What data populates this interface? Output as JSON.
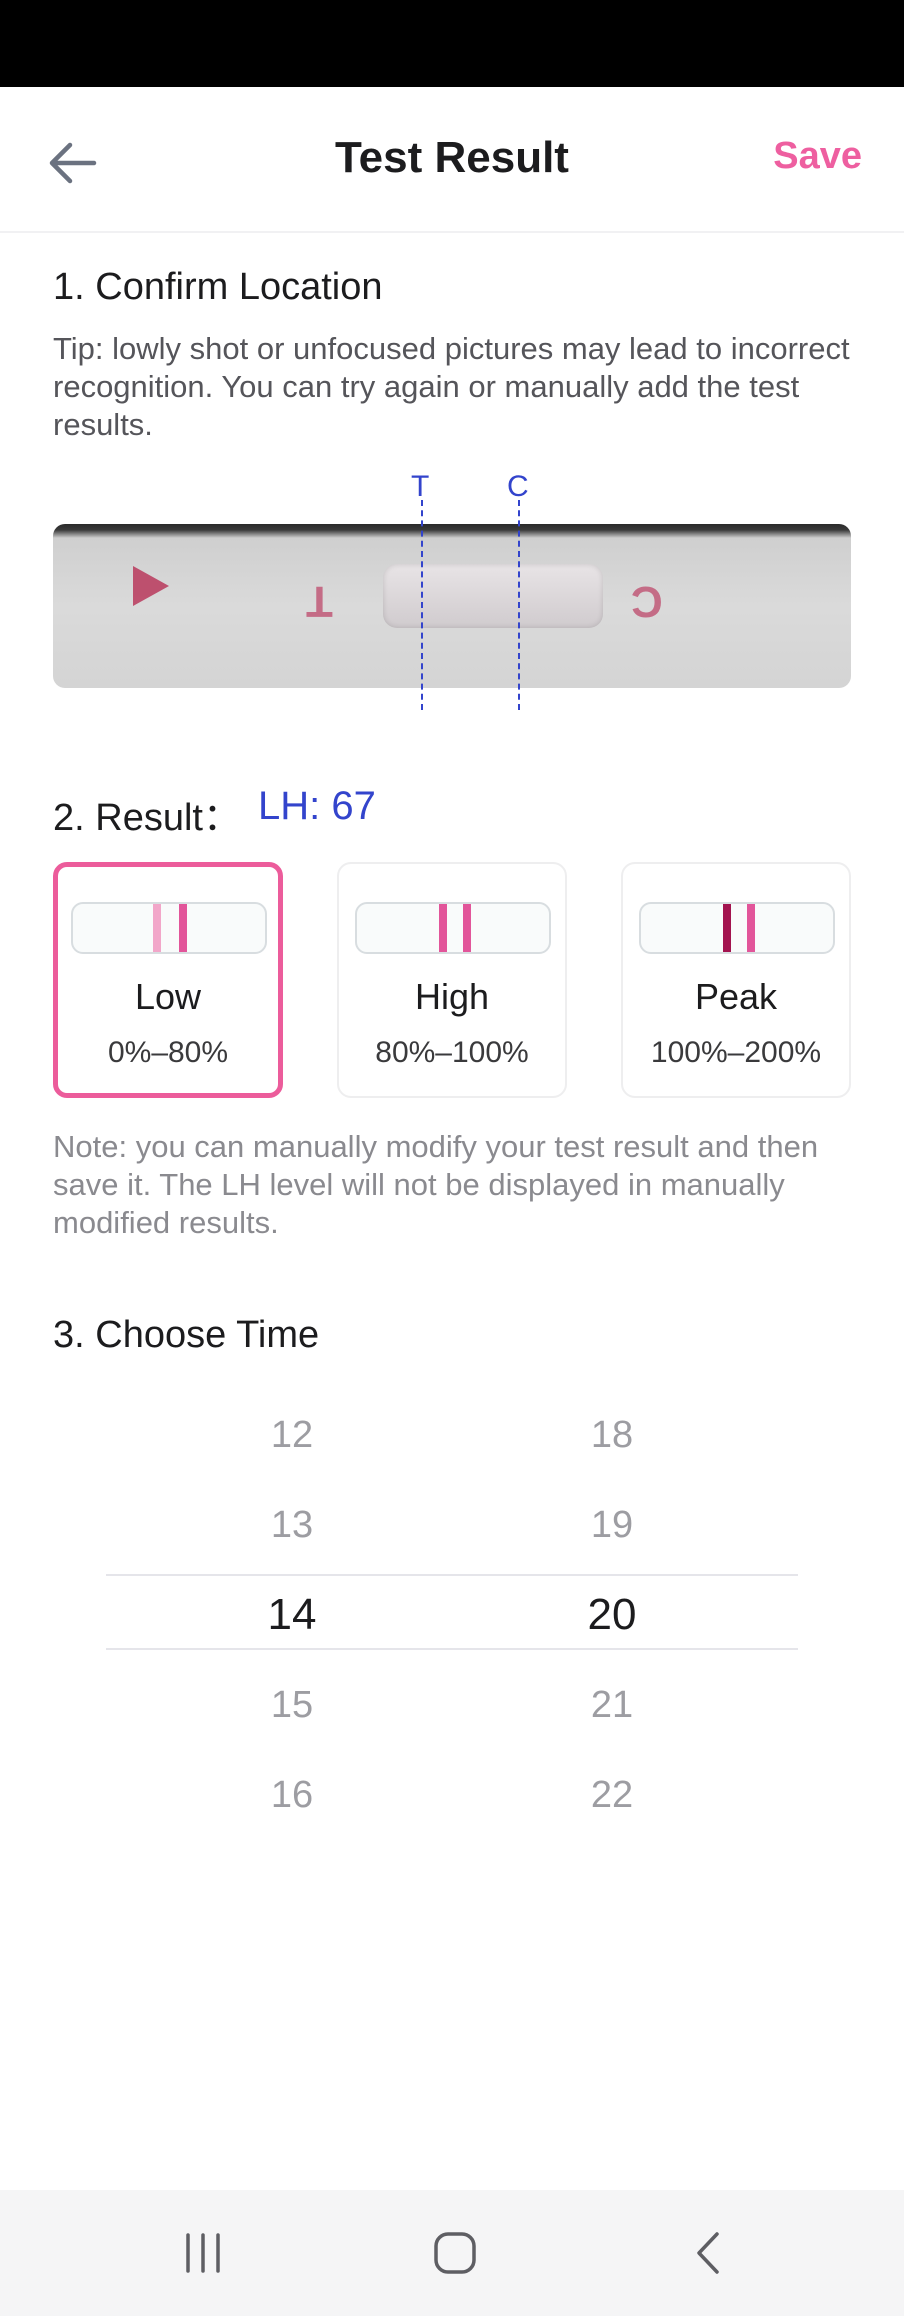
{
  "header": {
    "title": "Test Result",
    "save_label": "Save"
  },
  "location": {
    "heading": "1. Confirm Location",
    "tip": "Tip: lowly shot or unfocused pictures may lead to incorrect recognition. You can try again or manually add the test results.",
    "marker_t": "T",
    "marker_c": "C",
    "strip_letter_t": "T",
    "strip_letter_c": "C"
  },
  "result": {
    "heading": "2. Result：",
    "lh_value": "LH: 67",
    "options": [
      {
        "label": "Low",
        "range": "0%–80%",
        "selected": true,
        "t_color": "#f2a6c9",
        "c_color": "#e2559a"
      },
      {
        "label": "High",
        "range": "80%–100%",
        "selected": false,
        "t_color": "#e2559a",
        "c_color": "#e2559a"
      },
      {
        "label": "Peak",
        "range": "100%–200%",
        "selected": false,
        "t_color": "#a3134f",
        "c_color": "#e2559a"
      }
    ],
    "note": "Note: you can manually modify your test result and then save it. The LH level will not be displayed in manually modified results."
  },
  "time": {
    "heading": "3. Choose Time",
    "hours": [
      "12",
      "13",
      "14",
      "15",
      "16"
    ],
    "minutes": [
      "18",
      "19",
      "20",
      "21",
      "22"
    ],
    "selected_hour": "14",
    "selected_minute": "20"
  },
  "colors": {
    "accent": "#ee5fa0",
    "lh_blue": "#3344cc"
  },
  "icons": {
    "back": "arrow-left-icon",
    "recents": "recent-apps-icon",
    "home": "home-icon",
    "nav_back": "chevron-left-icon"
  }
}
